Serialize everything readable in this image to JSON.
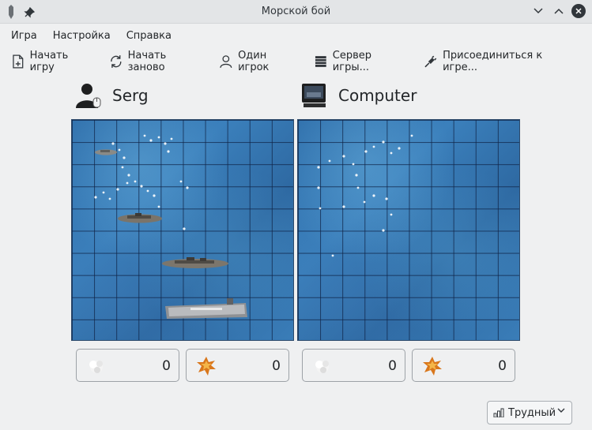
{
  "window": {
    "title": "Морской бой"
  },
  "menu": [
    "Игра",
    "Настройка",
    "Справка"
  ],
  "toolbar": {
    "new_game": "Начать игру",
    "restart": "Начать заново",
    "single_player": "Один игрок",
    "game_server": "Сервер игры...",
    "join_game": "Присоединиться к игре..."
  },
  "players": [
    {
      "name": "Serg",
      "misses": "0",
      "hits": "0"
    },
    {
      "name": "Computer",
      "misses": "0",
      "hits": "0"
    }
  ],
  "difficulty": {
    "value": "Трудный"
  }
}
